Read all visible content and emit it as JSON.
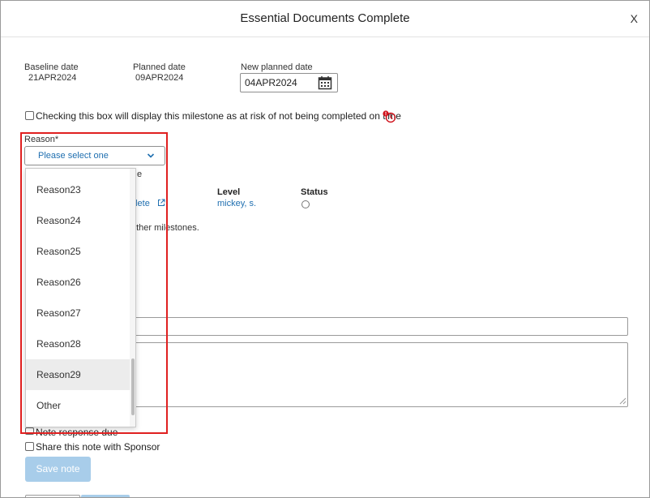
{
  "modal": {
    "title": "Essential Documents Complete",
    "close_label": "X"
  },
  "dates": {
    "baseline_label": "Baseline date",
    "baseline_value": "21APR2024",
    "planned_label": "Planned date",
    "planned_value": "09APR2024",
    "new_planned_label": "New planned date",
    "new_planned_value": "04APR2024"
  },
  "at_risk": {
    "label": "Checking this box will display this milestone as at risk of not being completed on time",
    "checked": false
  },
  "reason": {
    "label": "Reason*",
    "placeholder": "Please select one",
    "options": [
      {
        "label": "Reason23"
      },
      {
        "label": "Reason24"
      },
      {
        "label": "Reason25"
      },
      {
        "label": "Reason26"
      },
      {
        "label": "Reason27"
      },
      {
        "label": "Reason28"
      },
      {
        "label": "Reason29",
        "highlighted": true
      },
      {
        "label": "Other"
      }
    ]
  },
  "background": {
    "frag_e": "e",
    "link_fragment": "plete",
    "level_header": "Level",
    "level_value": "mickey, s.",
    "status_header": "Status",
    "other_milestones": "other milestones."
  },
  "note": {
    "response_due_label": "Note response due",
    "share_label": "Share this note with Sponsor",
    "save_label": "Save note"
  },
  "colors": {
    "accent_link": "#1f6fb0",
    "highlight_frame": "#e02020",
    "save_button_disabled": "#a8cdea",
    "warning_red": "#d0121b"
  }
}
